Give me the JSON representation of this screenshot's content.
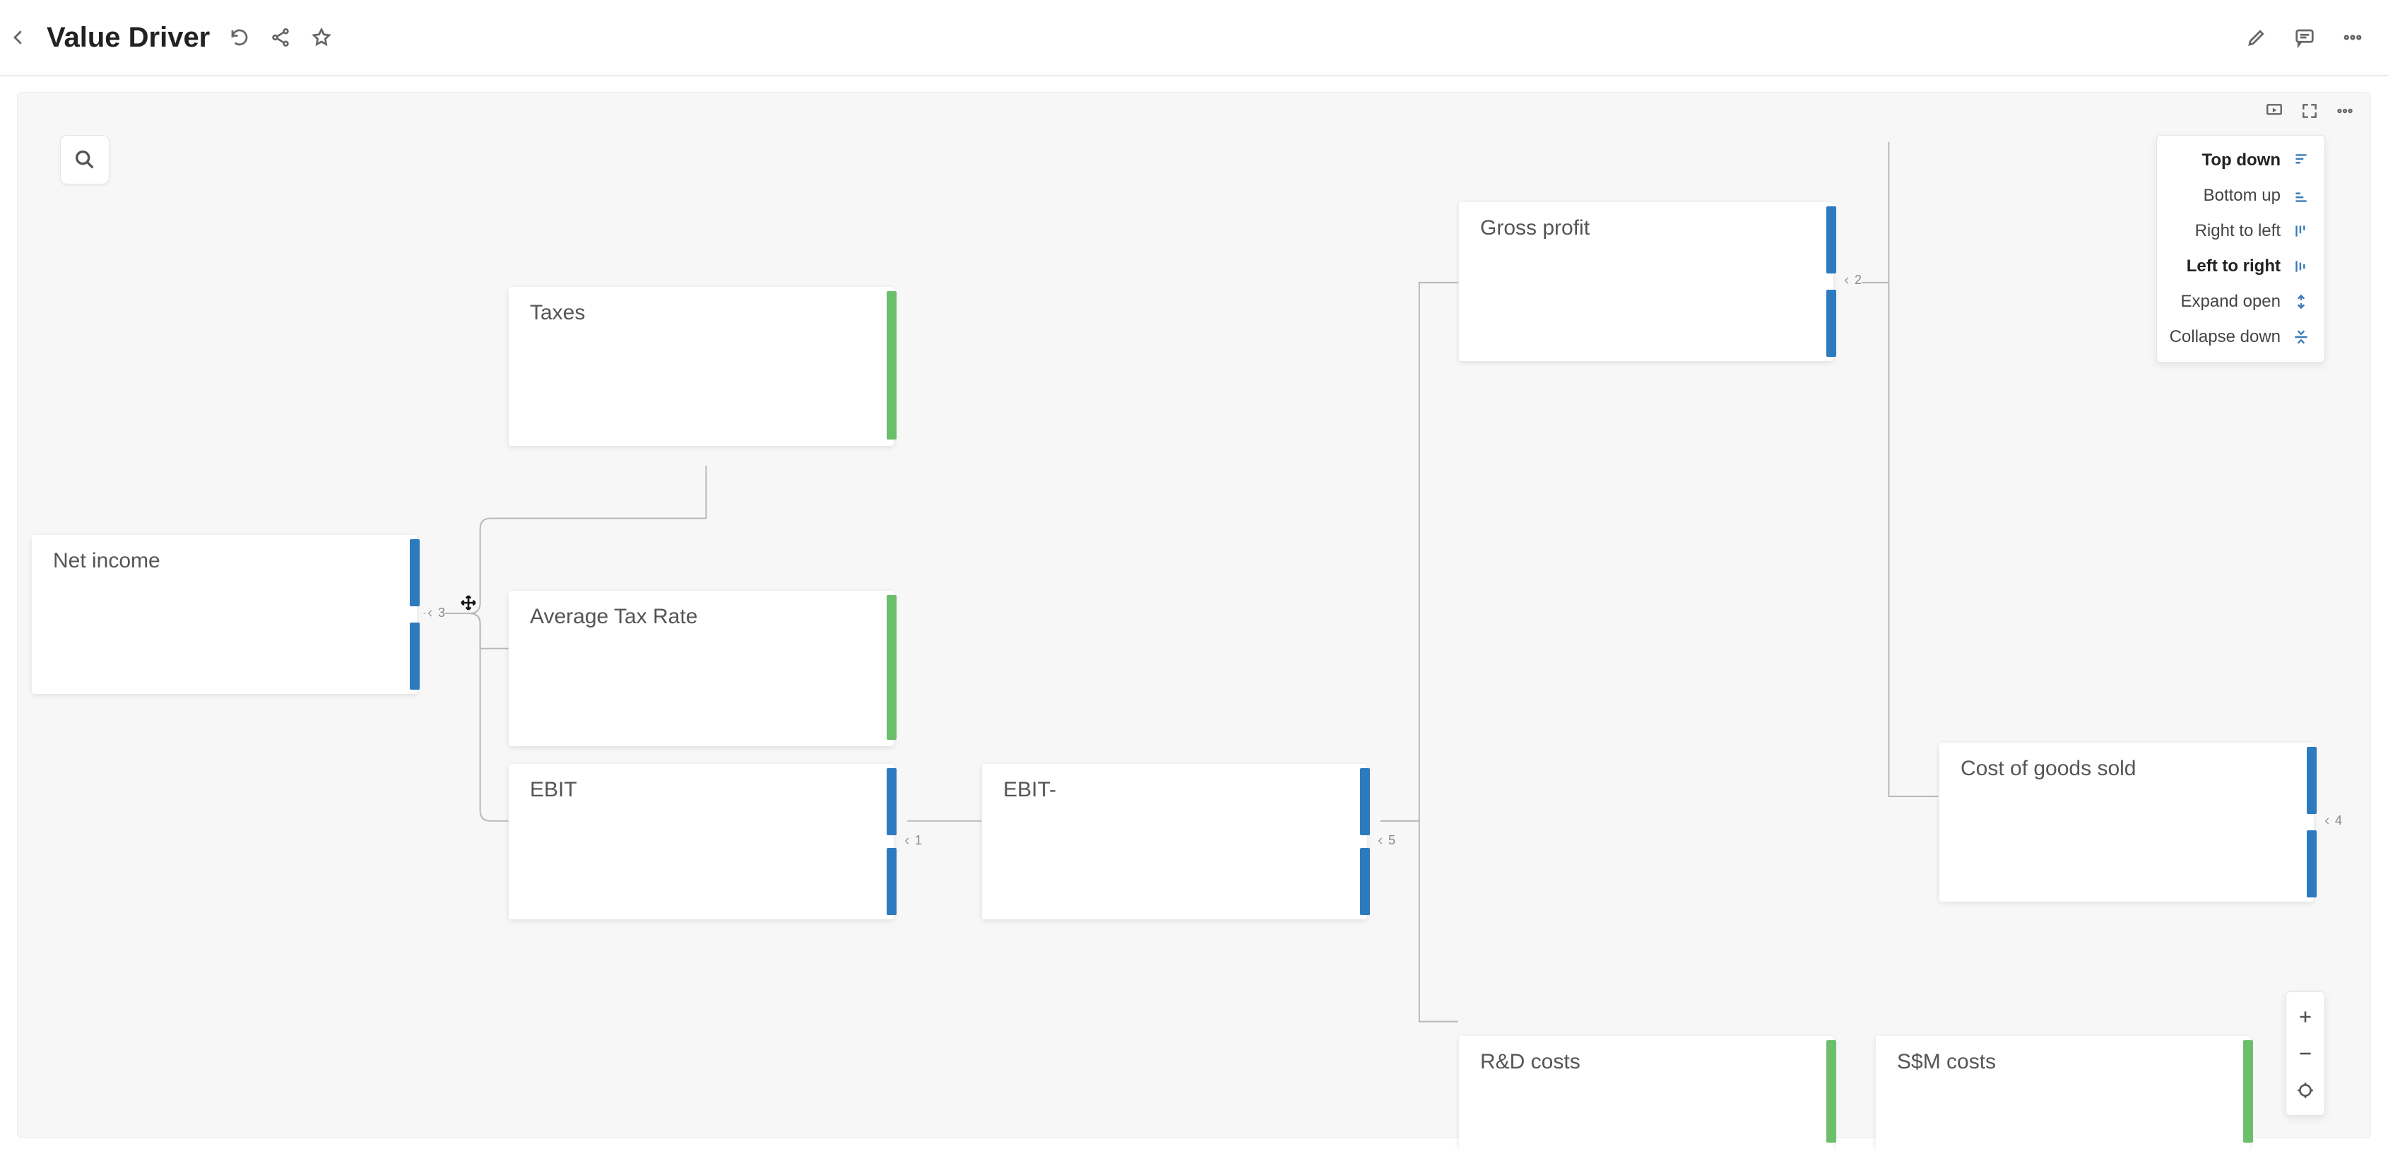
{
  "header": {
    "title": "Value Driver"
  },
  "layoutMenu": {
    "items": [
      {
        "label": "Top down"
      },
      {
        "label": "Bottom up"
      },
      {
        "label": "Right to left"
      },
      {
        "label": "Left to right"
      },
      {
        "label": "Expand open"
      },
      {
        "label": "Collapse down"
      }
    ]
  },
  "nodes": {
    "netIncome": {
      "label": "Net income",
      "badge": "3"
    },
    "taxes": {
      "label": "Taxes"
    },
    "avgTaxRate": {
      "label": "Average Tax Rate"
    },
    "ebit": {
      "label": "EBIT",
      "badge": "1"
    },
    "ebitDash": {
      "label": "EBIT-",
      "badge": "5"
    },
    "grossProfit": {
      "label": "Gross profit",
      "badge": "2"
    },
    "cogs": {
      "label": "Cost of goods sold",
      "badge": "4"
    },
    "rdCosts": {
      "label": "R&D costs"
    },
    "smCosts": {
      "label": "S$M costs"
    }
  }
}
